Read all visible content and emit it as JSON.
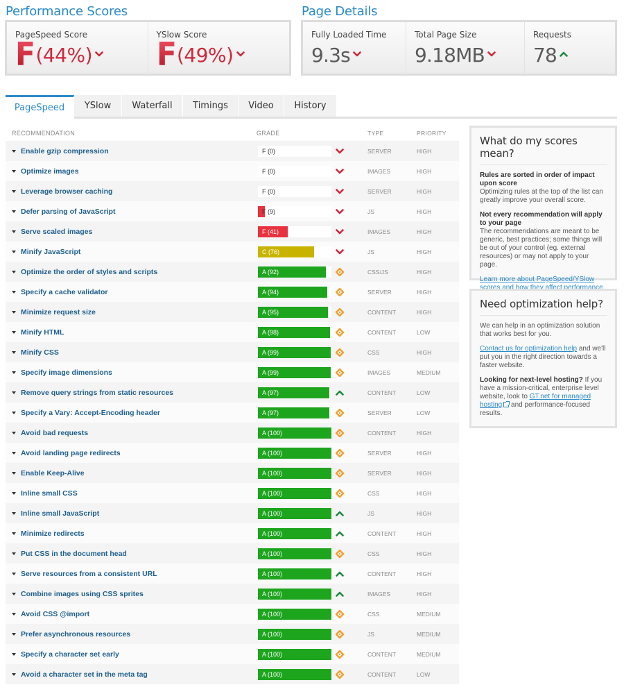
{
  "performance": {
    "title": "Performance Scores",
    "pagespeed": {
      "label": "PageSpeed Score",
      "grade": "F",
      "percent": "(44%)",
      "trend": "down"
    },
    "yslow": {
      "label": "YSlow Score",
      "grade": "F",
      "percent": "(49%)",
      "trend": "down"
    }
  },
  "details": {
    "title": "Page Details",
    "load_time": {
      "label": "Fully Loaded Time",
      "value": "9.3s",
      "trend": "down"
    },
    "page_size": {
      "label": "Total Page Size",
      "value": "9.18MB",
      "trend": "down"
    },
    "requests": {
      "label": "Requests",
      "value": "78",
      "trend": "up"
    }
  },
  "tabs": [
    {
      "label": "PageSpeed",
      "active": true
    },
    {
      "label": "YSlow",
      "active": false
    },
    {
      "label": "Waterfall",
      "active": false
    },
    {
      "label": "Timings",
      "active": false
    },
    {
      "label": "Video",
      "active": false
    },
    {
      "label": "History",
      "active": false
    }
  ],
  "table": {
    "headers": {
      "recommendation": "RECOMMENDATION",
      "grade": "GRADE",
      "type": "TYPE",
      "priority": "PRIORITY"
    },
    "rows": [
      {
        "name": "Enable gzip compression",
        "grade": "F (0)",
        "score": 0,
        "indicator": "down",
        "type": "SERVER",
        "priority": "HIGH"
      },
      {
        "name": "Optimize images",
        "grade": "F (0)",
        "score": 0,
        "indicator": "down",
        "type": "IMAGES",
        "priority": "HIGH"
      },
      {
        "name": "Leverage browser caching",
        "grade": "F (0)",
        "score": 0,
        "indicator": "down",
        "type": "SERVER",
        "priority": "HIGH"
      },
      {
        "name": "Defer parsing of JavaScript",
        "grade": "F (9)",
        "score": 9,
        "indicator": "down",
        "type": "JS",
        "priority": "HIGH"
      },
      {
        "name": "Serve scaled images",
        "grade": "F (41)",
        "score": 41,
        "indicator": "down",
        "type": "IMAGES",
        "priority": "HIGH"
      },
      {
        "name": "Minify JavaScript",
        "grade": "C (76)",
        "score": 76,
        "indicator": "down",
        "type": "JS",
        "priority": "HIGH"
      },
      {
        "name": "Optimize the order of styles and scripts",
        "grade": "A (92)",
        "score": 92,
        "indicator": "neutral",
        "type": "CSS/JS",
        "priority": "HIGH"
      },
      {
        "name": "Specify a cache validator",
        "grade": "A (94)",
        "score": 94,
        "indicator": "neutral",
        "type": "SERVER",
        "priority": "HIGH"
      },
      {
        "name": "Minimize request size",
        "grade": "A (95)",
        "score": 95,
        "indicator": "neutral",
        "type": "CONTENT",
        "priority": "HIGH"
      },
      {
        "name": "Minify HTML",
        "grade": "A (98)",
        "score": 98,
        "indicator": "neutral",
        "type": "CONTENT",
        "priority": "LOW"
      },
      {
        "name": "Minify CSS",
        "grade": "A (99)",
        "score": 99,
        "indicator": "neutral",
        "type": "CSS",
        "priority": "HIGH"
      },
      {
        "name": "Specify image dimensions",
        "grade": "A (99)",
        "score": 99,
        "indicator": "neutral",
        "type": "IMAGES",
        "priority": "MEDIUM"
      },
      {
        "name": "Remove query strings from static resources",
        "grade": "A (97)",
        "score": 97,
        "indicator": "up",
        "type": "CONTENT",
        "priority": "LOW"
      },
      {
        "name": "Specify a Vary: Accept-Encoding header",
        "grade": "A (97)",
        "score": 97,
        "indicator": "neutral",
        "type": "SERVER",
        "priority": "LOW"
      },
      {
        "name": "Avoid bad requests",
        "grade": "A (100)",
        "score": 100,
        "indicator": "neutral",
        "type": "CONTENT",
        "priority": "HIGH"
      },
      {
        "name": "Avoid landing page redirects",
        "grade": "A (100)",
        "score": 100,
        "indicator": "neutral",
        "type": "SERVER",
        "priority": "HIGH"
      },
      {
        "name": "Enable Keep-Alive",
        "grade": "A (100)",
        "score": 100,
        "indicator": "neutral",
        "type": "SERVER",
        "priority": "HIGH"
      },
      {
        "name": "Inline small CSS",
        "grade": "A (100)",
        "score": 100,
        "indicator": "neutral",
        "type": "CSS",
        "priority": "HIGH"
      },
      {
        "name": "Inline small JavaScript",
        "grade": "A (100)",
        "score": 100,
        "indicator": "up",
        "type": "JS",
        "priority": "HIGH"
      },
      {
        "name": "Minimize redirects",
        "grade": "A (100)",
        "score": 100,
        "indicator": "up",
        "type": "CONTENT",
        "priority": "HIGH"
      },
      {
        "name": "Put CSS in the document head",
        "grade": "A (100)",
        "score": 100,
        "indicator": "neutral",
        "type": "CSS",
        "priority": "HIGH"
      },
      {
        "name": "Serve resources from a consistent URL",
        "grade": "A (100)",
        "score": 100,
        "indicator": "up",
        "type": "CONTENT",
        "priority": "HIGH"
      },
      {
        "name": "Combine images using CSS sprites",
        "grade": "A (100)",
        "score": 100,
        "indicator": "up",
        "type": "IMAGES",
        "priority": "HIGH"
      },
      {
        "name": "Avoid CSS @import",
        "grade": "A (100)",
        "score": 100,
        "indicator": "neutral",
        "type": "CSS",
        "priority": "MEDIUM"
      },
      {
        "name": "Prefer asynchronous resources",
        "grade": "A (100)",
        "score": 100,
        "indicator": "neutral",
        "type": "JS",
        "priority": "MEDIUM"
      },
      {
        "name": "Specify a character set early",
        "grade": "A (100)",
        "score": 100,
        "indicator": "neutral",
        "type": "CONTENT",
        "priority": "MEDIUM"
      },
      {
        "name": "Avoid a character set in the meta tag",
        "grade": "A (100)",
        "score": 100,
        "indicator": "neutral",
        "type": "CONTENT",
        "priority": "LOW"
      }
    ]
  },
  "sidebar": {
    "scores_panel": {
      "title": "What do my scores mean?",
      "p1_bold": "Rules are sorted in order of impact upon score",
      "p1_text": "Optimizing rules at the top of the list can greatly improve your overall score.",
      "p2_bold": "Not every recommendation will apply to your page",
      "p2_text": "The recommendations are meant to be generic, best practices; some things will be out of your control (eg. external resources) or may not apply to your page.",
      "link": "Learn more about PageSpeed/YSlow scores and how they affect performance."
    },
    "help_panel": {
      "title": "Need optimization help?",
      "p1": "We can help in an optimization solution that works best for you.",
      "p2_link": "Contact us for optimization help",
      "p2_text": " and we'll put you in the right direction towards a faster website.",
      "p3_bold": "Looking for next-level hosting?",
      "p3_text": " If you have a mission-critical, enterprise level website, look to ",
      "p3_link": "GT.net for managed hosting",
      "p3_end": " and performance-focused results."
    }
  },
  "colors": {
    "accent": "#2a8ac8",
    "grade_f": "#e8323e",
    "grade_c": "#c8b400",
    "grade_a": "#1ea51e",
    "trend_down": "#d0283b",
    "trend_up": "#1e8a3c",
    "neutral": "#f0a030"
  }
}
